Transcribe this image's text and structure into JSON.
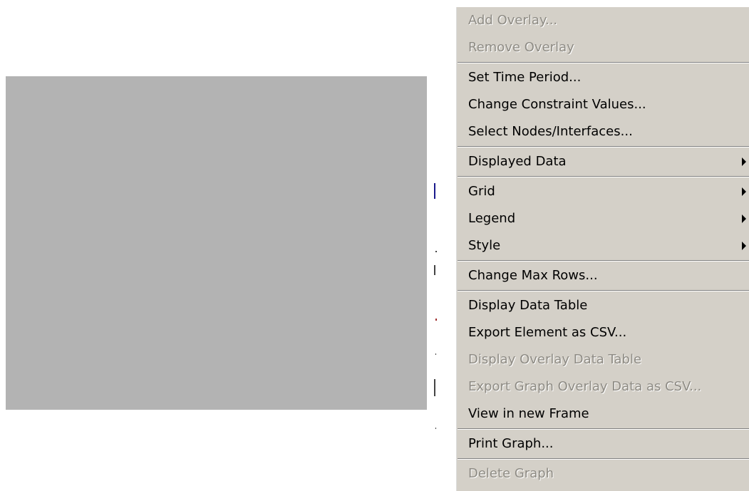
{
  "context_menu": {
    "groups": [
      [
        {
          "label": "Add Overlay...",
          "enabled": false,
          "submenu": false
        },
        {
          "label": "Remove Overlay",
          "enabled": false,
          "submenu": false
        }
      ],
      [
        {
          "label": "Set Time Period...",
          "enabled": true,
          "submenu": false
        },
        {
          "label": "Change Constraint Values...",
          "enabled": true,
          "submenu": false
        },
        {
          "label": "Select Nodes/Interfaces...",
          "enabled": true,
          "submenu": false
        }
      ],
      [
        {
          "label": "Displayed Data",
          "enabled": true,
          "submenu": true
        }
      ],
      [
        {
          "label": "Grid",
          "enabled": true,
          "submenu": true
        },
        {
          "label": "Legend",
          "enabled": true,
          "submenu": true
        },
        {
          "label": "Style",
          "enabled": true,
          "submenu": true
        }
      ],
      [
        {
          "label": "Change Max Rows...",
          "enabled": true,
          "submenu": false
        }
      ],
      [
        {
          "label": "Display Data Table",
          "enabled": true,
          "submenu": false
        },
        {
          "label": "Export Element as CSV...",
          "enabled": true,
          "submenu": false
        },
        {
          "label": "Display Overlay Data Table",
          "enabled": false,
          "submenu": false
        },
        {
          "label": "Export Graph Overlay Data as CSV...",
          "enabled": false,
          "submenu": false
        },
        {
          "label": "View in new Frame",
          "enabled": true,
          "submenu": false
        }
      ],
      [
        {
          "label": "Print Graph...",
          "enabled": true,
          "submenu": false
        }
      ],
      [
        {
          "label": "Delete Graph",
          "enabled": false,
          "submenu": false
        }
      ]
    ]
  },
  "colors": {
    "menu_background": "#d4d0c8",
    "disabled_text": "#8e8b84",
    "placeholder_panel": "#b3b3b3"
  }
}
